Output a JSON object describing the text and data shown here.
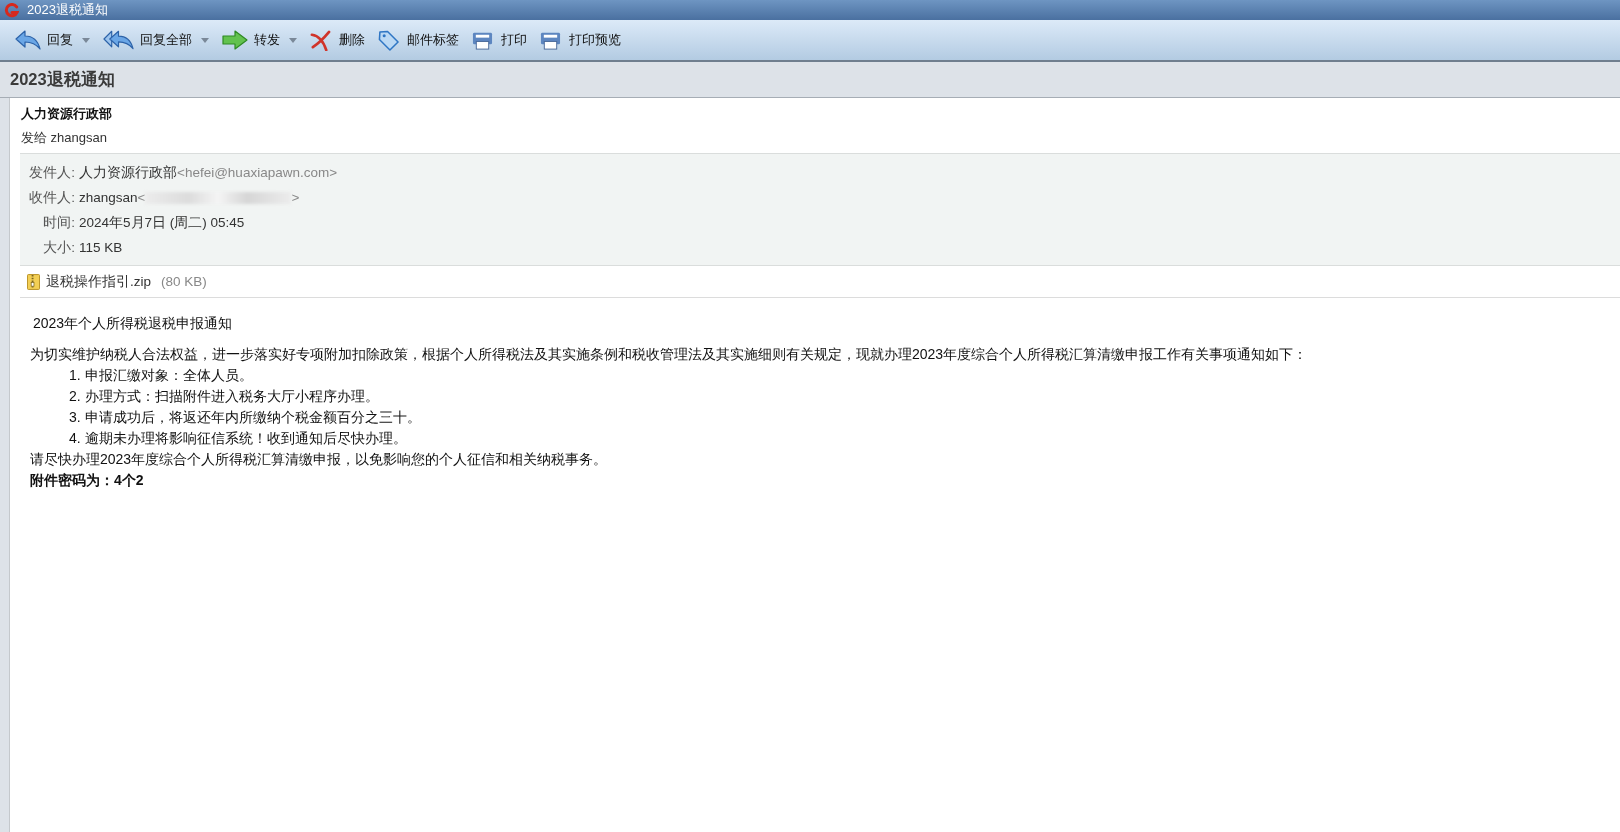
{
  "window": {
    "title": "2023退税通知"
  },
  "toolbar": [
    {
      "kind": "reply",
      "label": "回复",
      "dropdown": true
    },
    {
      "kind": "replyall",
      "label": "回复全部",
      "dropdown": true
    },
    {
      "kind": "forward",
      "label": "转发",
      "dropdown": true
    },
    {
      "kind": "delete",
      "label": "删除",
      "dropdown": false
    },
    {
      "kind": "tag",
      "label": "邮件标签",
      "dropdown": false
    },
    {
      "kind": "print",
      "label": "打印",
      "dropdown": false
    },
    {
      "kind": "preview",
      "label": "打印预览",
      "dropdown": false
    }
  ],
  "subject": "2023退税通知",
  "message": {
    "sender_name": "人力资源行政部",
    "sent_to": "发给 zhangsan",
    "details": [
      {
        "label": "发件人:",
        "value": "人力资源行政部",
        "address": "<hefei@huaxiapawn.com>",
        "redacted": false
      },
      {
        "label": "收件人:",
        "value": "zhangsan",
        "address": "<",
        "redacted": true,
        "address_end": ">"
      },
      {
        "label": "时间:",
        "value": "2024年5月7日 (周二) 05:45",
        "redacted": false
      },
      {
        "label": "大小:",
        "value": "115 KB",
        "redacted": false
      }
    ],
    "attachment": {
      "name": "退税操作指引.zip",
      "size": "(80 KB)"
    },
    "body": {
      "title": "2023年个人所得税退税申报通知",
      "intro": "为切实维护纳税人合法权益，进一步落实好专项附加扣除政策，根据个人所得税法及其实施条例和税收管理法及其实施细则有关规定，现就办理2023年度综合个人所得税汇算清缴申报工作有关事项通知如下：",
      "items": [
        "1. 申报汇缴对象：全体人员。",
        "2. 办理方式：扫描附件进入税务大厅小程序办理。",
        "3. 申请成功后，将返还年内所缴纳个税金额百分之三十。",
        "4. 逾期未办理将影响征信系统！收到通知后尽快办理。"
      ],
      "closing": "请尽快办理2023年度综合个人所得税汇算清缴申报，以免影响您的个人征信和相关纳税事务。",
      "password_note": "附件密码为：4个2"
    }
  }
}
